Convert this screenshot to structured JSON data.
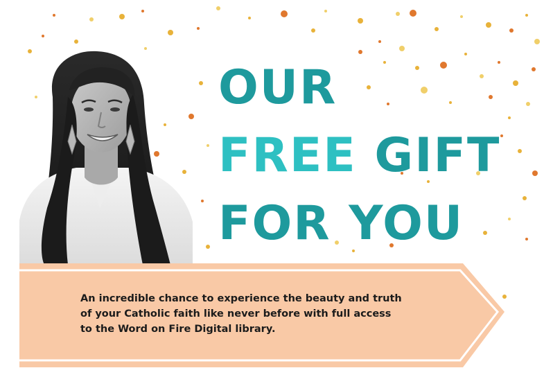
{
  "headline": {
    "line1": "OUR",
    "line2_word1": "FREE",
    "line2_word2": "GIFT",
    "line3": "FOR YOU"
  },
  "banner": {
    "text": "An incredible chance to experience the beauty and truth of your Catholic faith like never before with full access to the Word on Fire Digital library."
  },
  "colors": {
    "headline_teal": "#1e9a9d",
    "headline_light_teal": "#2ec0c2",
    "ribbon_peach": "#f9c9a6",
    "confetti_gold": "#e8b23a",
    "confetti_orange": "#e0782e",
    "text_dark": "#1b1b1b"
  },
  "icons": {
    "portrait": "woman-portrait-photo",
    "background": "gold-confetti-dots"
  }
}
